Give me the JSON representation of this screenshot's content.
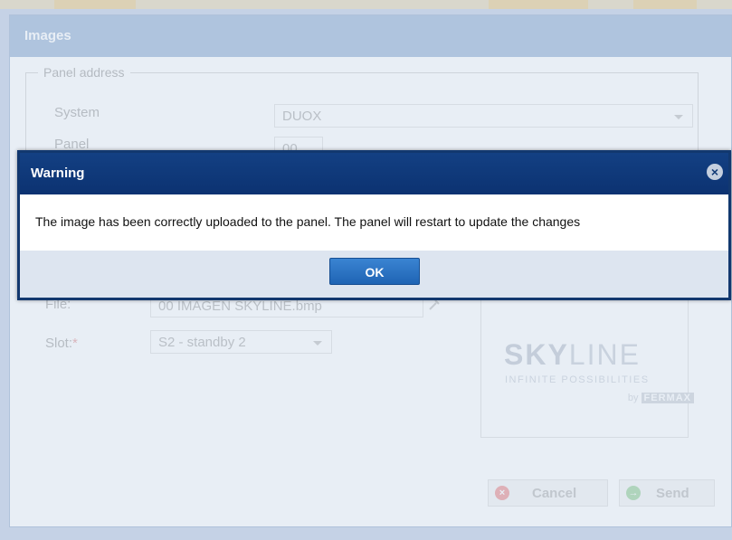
{
  "window": {
    "title": "Images"
  },
  "panel_address": {
    "legend": "Panel address",
    "system_label": "System",
    "system_value": "DUOX",
    "panel_label": "Panel",
    "panel_value": "00"
  },
  "upload": {
    "file_label": "File:",
    "file_value": "00 IMAGEN SKYLINE.bmp",
    "slot_label": "Slot:",
    "slot_required": "*",
    "slot_value": "S2 - standby 2"
  },
  "preview": {
    "brand_bold": "SKY",
    "brand_light": "LINE",
    "tagline": "INFINITE POSSIBILITIES",
    "by": "by",
    "maker": "FERMAX"
  },
  "actions": {
    "cancel_label": "Cancel",
    "send_label": "Send"
  },
  "dialog": {
    "title": "Warning",
    "message": "The image has been correctly uploaded to the panel. The panel will restart to update the changes",
    "ok_label": "OK"
  },
  "colors": {
    "dialog_header": "#0c3271",
    "window_header": "#a8bfdc",
    "ok_button": "#2a72c4",
    "cancel_icon": "#f0a0a0",
    "send_icon": "#a8d8a8"
  },
  "icons": {
    "close": "close-circle-icon",
    "cancel": "cancel-icon",
    "send": "send-arrow-icon",
    "file_browse": "file-browse-icon"
  }
}
